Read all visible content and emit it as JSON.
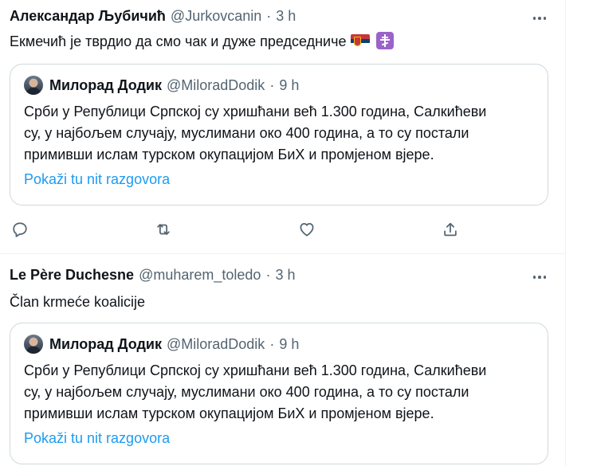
{
  "tweets": [
    {
      "author_name": "Александар Љубичић",
      "author_handle": "@Jurkovcanin",
      "separator": "·",
      "time": "3 h",
      "text": "Екмечић је тврдио да смо чак и дуже председниче",
      "emojis": [
        "serbia-flag-icon",
        "orthodox-cross-icon"
      ],
      "quote": {
        "author_name": "Милорад Додик",
        "author_handle": "@MiloradDodik",
        "separator": "·",
        "time": "9 h",
        "lines": [
          "Срби у Републици Српској су хришћани већ 1.300 година, Салкићеви",
          "су, у најбољем случају, муслимани око 400 година, а то су постали",
          "примивши ислам турском окупацијом БиХ и промјеном вјере."
        ],
        "link": "Pokaži tu nit razgovora"
      }
    },
    {
      "author_name": "Le Père Duchesne",
      "author_handle": "@muharem_toledo",
      "separator": "·",
      "time": "3 h",
      "text": "Član krmeće koalicije",
      "quote": {
        "author_name": "Милорад Додик",
        "author_handle": "@MiloradDodik",
        "separator": "·",
        "time": "9 h",
        "lines": [
          "Срби у Републици Српској су хришћани већ 1.300 година, Салкићеви",
          "су, у најбољем случају, муслимани око 400 година, а то су постали",
          "примивши ислам турском окупацијом БиХ и промјеном вјере."
        ],
        "link": "Pokaži tu nit razgovora"
      }
    }
  ],
  "action_icons": [
    "reply-icon",
    "retweet-icon",
    "like-icon",
    "share-icon"
  ],
  "colors": {
    "text": "#0f1419",
    "secondary": "#536471",
    "link": "#1d9bf0",
    "border": "#cfd9de"
  }
}
